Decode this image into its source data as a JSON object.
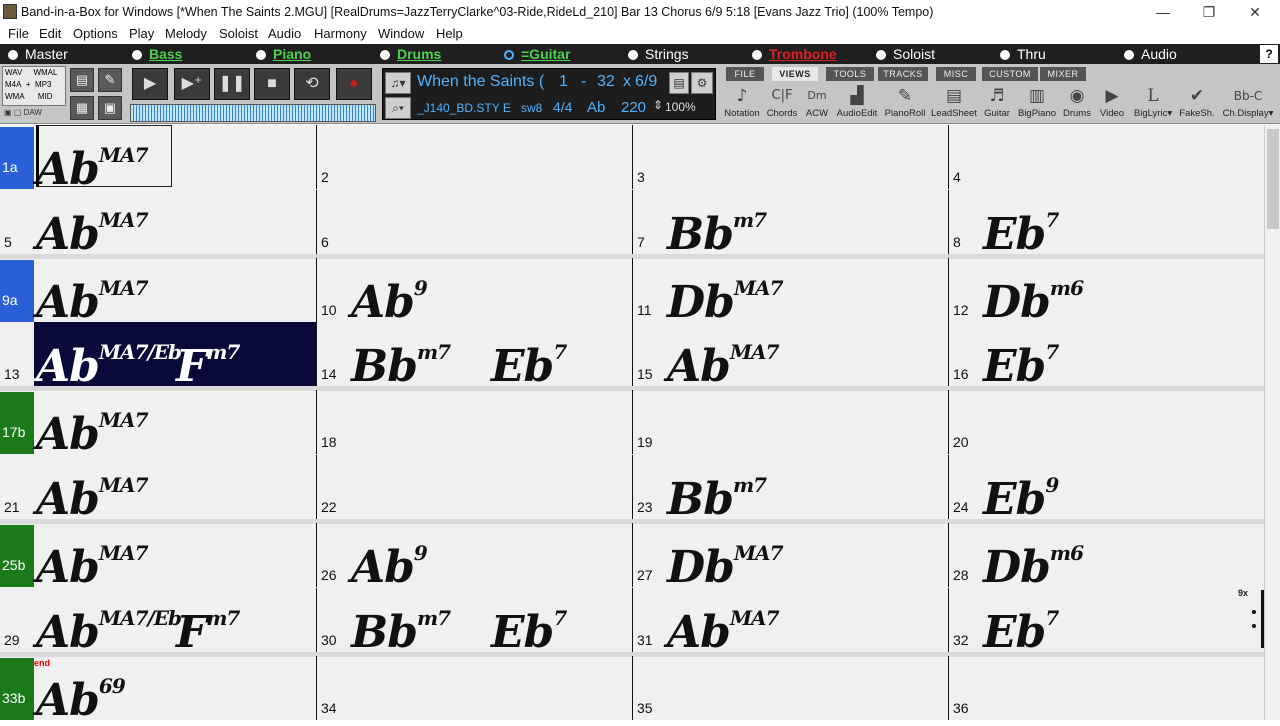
{
  "titlebar": {
    "title": "Band-in-a-Box for Windows  [*When The Saints 2.MGU] [RealDrums=JazzTerryClarke^03-Ride,RideLd_210] Bar 13 Chorus 6/9   5:18  [Evans Jazz Trio] (100% Tempo)",
    "minimize": "—",
    "restore": "❐",
    "close": "✕"
  },
  "menu": [
    "File",
    "Edit",
    "Options",
    "Play",
    "Melody",
    "Soloist",
    "Audio",
    "Harmony",
    "Window",
    "Help"
  ],
  "tracks": [
    {
      "label": "Master",
      "color": "#ffffff"
    },
    {
      "label": "Bass",
      "color": "#4cd14c"
    },
    {
      "label": "Piano",
      "color": "#4cd14c"
    },
    {
      "label": "Drums",
      "color": "#4cd14c"
    },
    {
      "label": "=Guitar",
      "color": "#4cd14c"
    },
    {
      "label": "Strings",
      "color": "#ffffff"
    },
    {
      "label": "Trombone",
      "color": "#e02020"
    },
    {
      "label": "Soloist",
      "color": "#ffffff"
    },
    {
      "label": "Thru",
      "color": "#ffffff"
    },
    {
      "label": "Audio",
      "color": "#ffffff"
    }
  ],
  "help_label": "?",
  "formats": {
    "wav": "WAV",
    "wmal": "WMAL",
    "m4a": "M4A",
    "plus": "+",
    "mp3": "MP3",
    "wma": "WMA",
    "mid": "MID",
    "daw": "DAW"
  },
  "song": {
    "title": "When the Saints (",
    "start": "1",
    "dash": "-",
    "end": "32",
    "times": "x",
    "chorus": "6/9",
    "style": "_J140_BD.STY E",
    "swing": "sw8",
    "time_sig": "4/4",
    "key": "Ab",
    "tempo": "220",
    "tempo_pct": "100%"
  },
  "tabs": [
    "FILE",
    "VIEWS",
    "TOOLS",
    "TRACKS",
    "MISC",
    "CUSTOM",
    "MIXER"
  ],
  "view_buttons": [
    {
      "label": "Notation",
      "icon": "♪"
    },
    {
      "label": "Chords",
      "icon": "C|F"
    },
    {
      "label": "ACW",
      "icon": "Dm"
    },
    {
      "label": "AudioEdit",
      "icon": "▟"
    },
    {
      "label": "PianoRoll",
      "icon": "✎"
    },
    {
      "label": "LeadSheet",
      "icon": "▤"
    },
    {
      "label": "Guitar",
      "icon": "♬"
    },
    {
      "label": "BigPiano",
      "icon": "▥"
    },
    {
      "label": "Drums",
      "icon": "◉"
    },
    {
      "label": "Video",
      "icon": "▶"
    },
    {
      "label": "BigLyric▾",
      "icon": "L"
    },
    {
      "label": "FakeSh.",
      "icon": "✔"
    },
    {
      "label": "Ch.Display▾",
      "icon": "Bb-C"
    }
  ],
  "bars": [
    {
      "num": "1a",
      "chords": [
        {
          "root": "Ab",
          "q": "MA7"
        }
      ],
      "part": "a"
    },
    {
      "num": "2",
      "chords": []
    },
    {
      "num": "3",
      "chords": []
    },
    {
      "num": "4",
      "chords": []
    },
    {
      "num": "5",
      "chords": [
        {
          "root": "Ab",
          "q": "MA7"
        }
      ]
    },
    {
      "num": "6",
      "chords": []
    },
    {
      "num": "7",
      "chords": [
        {
          "root": "Bb",
          "q": "m7"
        }
      ]
    },
    {
      "num": "8",
      "chords": [
        {
          "root": "Eb",
          "q": "7"
        }
      ]
    },
    {
      "num": "9a",
      "chords": [
        {
          "root": "Ab",
          "q": "MA7"
        }
      ],
      "part": "a"
    },
    {
      "num": "10",
      "chords": [
        {
          "root": "Ab",
          "q": "9"
        }
      ]
    },
    {
      "num": "11",
      "chords": [
        {
          "root": "Db",
          "q": "MA7"
        }
      ]
    },
    {
      "num": "12",
      "chords": [
        {
          "root": "Db",
          "q": "m6"
        }
      ]
    },
    {
      "num": "13",
      "chords": [
        {
          "root": "Ab",
          "q": "MA7/Eb"
        },
        {
          "root": "F",
          "q": "m7"
        }
      ]
    },
    {
      "num": "14",
      "chords": [
        {
          "root": "Bb",
          "q": "m7"
        },
        {
          "root": "Eb",
          "q": "7"
        }
      ]
    },
    {
      "num": "15",
      "chords": [
        {
          "root": "Ab",
          "q": "MA7"
        }
      ]
    },
    {
      "num": "16",
      "chords": [
        {
          "root": "Eb",
          "q": "7"
        }
      ]
    },
    {
      "num": "17b",
      "chords": [
        {
          "root": "Ab",
          "q": "MA7"
        }
      ],
      "part": "b"
    },
    {
      "num": "18",
      "chords": []
    },
    {
      "num": "19",
      "chords": []
    },
    {
      "num": "20",
      "chords": []
    },
    {
      "num": "21",
      "chords": [
        {
          "root": "Ab",
          "q": "MA7"
        }
      ]
    },
    {
      "num": "22",
      "chords": []
    },
    {
      "num": "23",
      "chords": [
        {
          "root": "Bb",
          "q": "m7"
        }
      ]
    },
    {
      "num": "24",
      "chords": [
        {
          "root": "Eb",
          "q": "9"
        }
      ]
    },
    {
      "num": "25b",
      "chords": [
        {
          "root": "Ab",
          "q": "MA7"
        }
      ],
      "part": "b"
    },
    {
      "num": "26",
      "chords": [
        {
          "root": "Ab",
          "q": "9"
        }
      ]
    },
    {
      "num": "27",
      "chords": [
        {
          "root": "Db",
          "q": "MA7"
        }
      ]
    },
    {
      "num": "28",
      "chords": [
        {
          "root": "Db",
          "q": "m6"
        }
      ]
    },
    {
      "num": "29",
      "chords": [
        {
          "root": "Ab",
          "q": "MA7/Eb"
        },
        {
          "root": "F",
          "q": "m7"
        }
      ]
    },
    {
      "num": "30",
      "chords": [
        {
          "root": "Bb",
          "q": "m7"
        },
        {
          "root": "Eb",
          "q": "7"
        }
      ]
    },
    {
      "num": "31",
      "chords": [
        {
          "root": "Ab",
          "q": "MA7"
        }
      ]
    },
    {
      "num": "32",
      "chords": [
        {
          "root": "Eb",
          "q": "7"
        }
      ]
    },
    {
      "num": "33b",
      "chords": [
        {
          "root": "Ab",
          "q": "69"
        }
      ],
      "part": "b",
      "end": "end"
    },
    {
      "num": "34",
      "chords": []
    },
    {
      "num": "35",
      "chords": []
    },
    {
      "num": "36",
      "chords": []
    }
  ],
  "repeat_mark": "9x",
  "current_bar": "13",
  "colors": {
    "part_a": "#2a5fd8",
    "part_b": "#1a7a1a",
    "highlight": "#0a0a3a"
  }
}
